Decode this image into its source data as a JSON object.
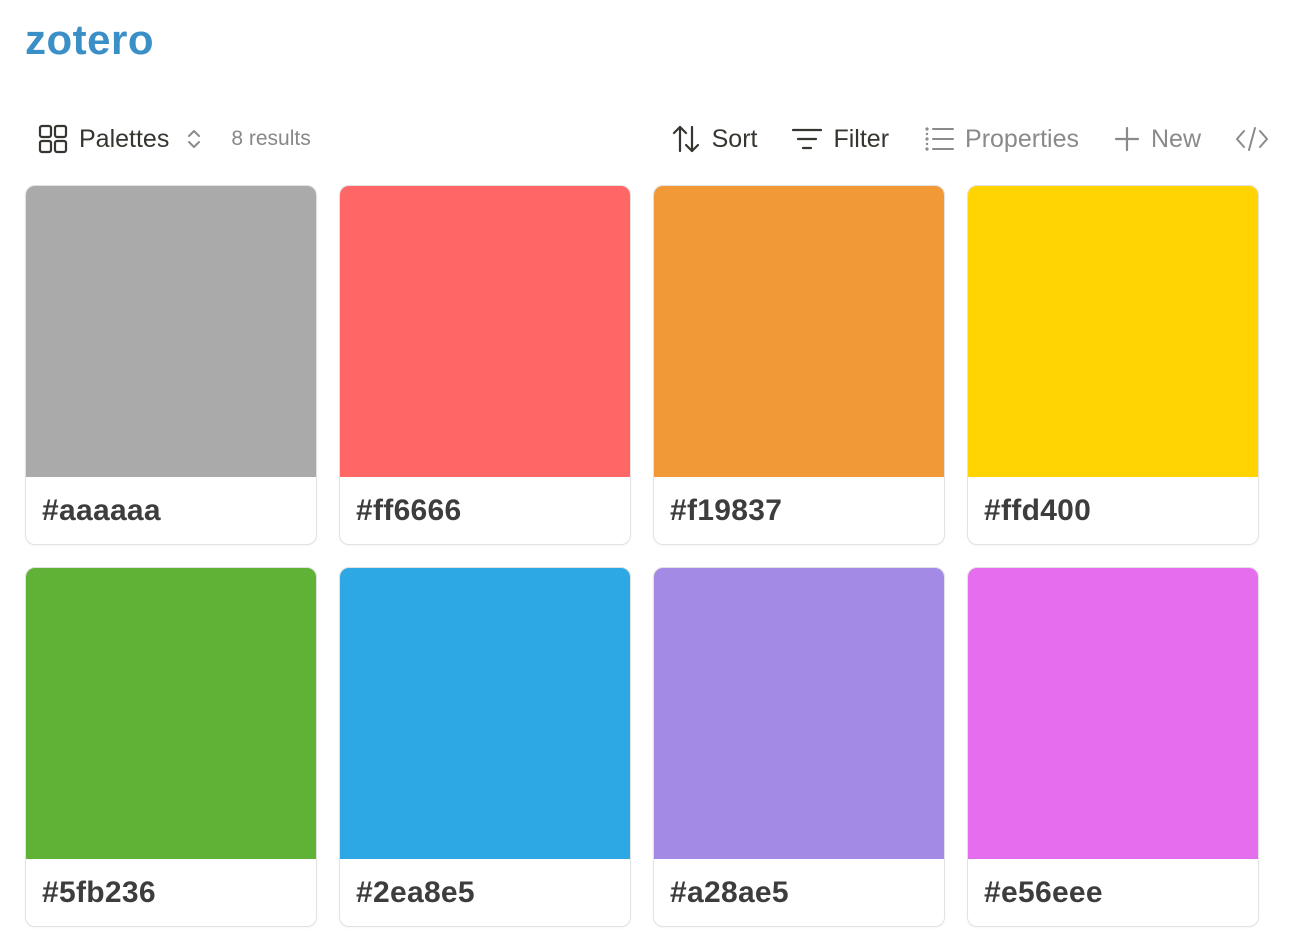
{
  "app": {
    "title": "zotero",
    "title_color": "#3a8fc6"
  },
  "toolbar": {
    "view_label": "Palettes",
    "view_icon": "grid-icon",
    "results": "8 results",
    "sort_label": "Sort",
    "filter_label": "Filter",
    "properties_label": "Properties",
    "new_label": "New",
    "embed_icon": "code-icon"
  },
  "palettes": [
    {
      "hex": "#aaaaaa",
      "color": "#aaaaaa"
    },
    {
      "hex": "#ff6666",
      "color": "#ff6666"
    },
    {
      "hex": "#f19837",
      "color": "#f19837"
    },
    {
      "hex": "#ffd400",
      "color": "#ffd400"
    },
    {
      "hex": "#5fb236",
      "color": "#5fb236"
    },
    {
      "hex": "#2ea8e5",
      "color": "#2ea8e5"
    },
    {
      "hex": "#a28ae5",
      "color": "#a28ae5"
    },
    {
      "hex": "#e56eee",
      "color": "#e56eee"
    }
  ]
}
